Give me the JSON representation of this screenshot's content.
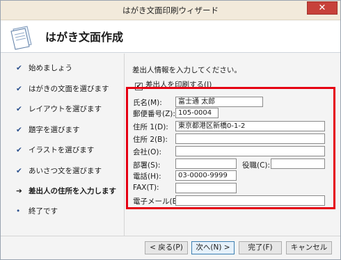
{
  "window": {
    "title": "はがき文面印刷ウィザード",
    "close_glyph": "✕"
  },
  "header": {
    "title": "はがき文面作成",
    "icon": "postcard-icon"
  },
  "steps": [
    {
      "label": "始めましょう",
      "state": "done"
    },
    {
      "label": "はがきの文面を選びます",
      "state": "done"
    },
    {
      "label": "レイアウトを選びます",
      "state": "done"
    },
    {
      "label": "題字を選びます",
      "state": "done"
    },
    {
      "label": "イラストを選びます",
      "state": "done"
    },
    {
      "label": "あいさつ文を選びます",
      "state": "done"
    },
    {
      "label": "差出人の住所を入力します",
      "state": "current"
    },
    {
      "label": "終了です",
      "state": "pending"
    }
  ],
  "step_marks": {
    "done": "✔",
    "current": "➔",
    "pending": "•"
  },
  "main": {
    "instruction": "差出人情報を入力してください。",
    "print_sender_checkbox": {
      "label": "差出人を印刷する(I)",
      "checked": true,
      "check_glyph": "✔"
    },
    "fields": {
      "name": {
        "label": "氏名(M):",
        "value": "富士通 太郎"
      },
      "postal": {
        "label": "郵便番号(Z):",
        "value": "105-0004"
      },
      "address1": {
        "label": "住所 1(D):",
        "value": "東京都港区新橋0-1-2"
      },
      "address2": {
        "label": "住所 2(B):",
        "value": ""
      },
      "company": {
        "label": "会社(O):",
        "value": ""
      },
      "department": {
        "label": "部署(S):",
        "value": ""
      },
      "position": {
        "label": "役職(C):",
        "value": ""
      },
      "phone": {
        "label": "電話(H):",
        "value": "03-0000-9999"
      },
      "fax": {
        "label": "FAX(T):",
        "value": ""
      },
      "email": {
        "label": "電子メール(E):",
        "value": ""
      }
    }
  },
  "buttons": {
    "back": "< 戻る(P)",
    "next": "次へ(N) >",
    "finish": "完了(F)",
    "cancel": "キャンセル"
  },
  "colors": {
    "highlight_border": "#e50012",
    "close_button": "#c7413a",
    "title_bar": "#f2eadb"
  }
}
